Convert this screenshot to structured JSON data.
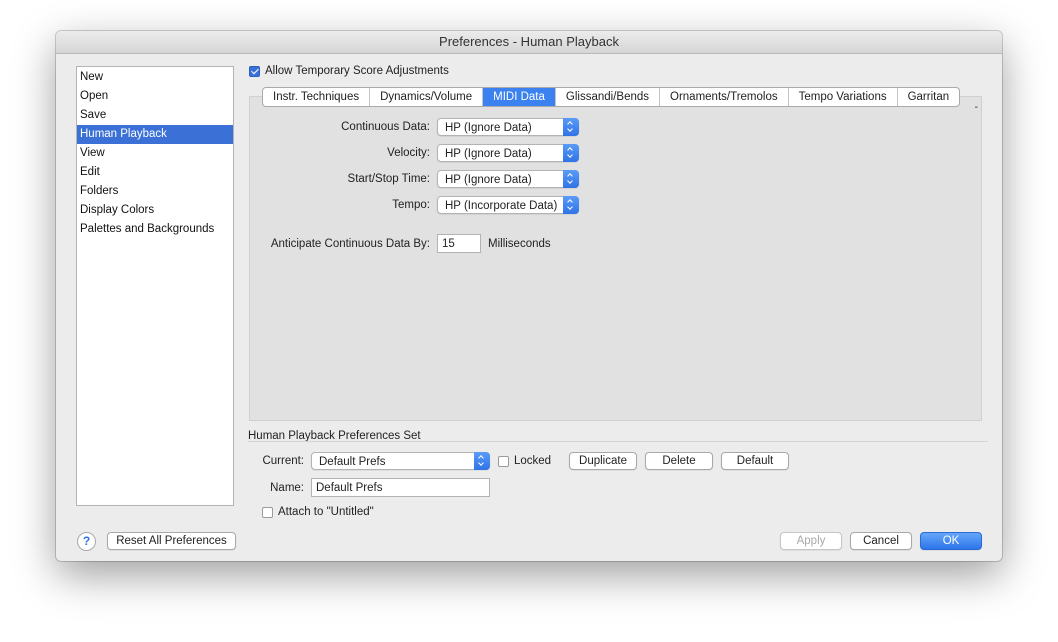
{
  "window": {
    "title": "Preferences - Human Playback"
  },
  "sidebar": {
    "items": [
      {
        "label": "New"
      },
      {
        "label": "Open"
      },
      {
        "label": "Save"
      },
      {
        "label": "Human Playback"
      },
      {
        "label": "View"
      },
      {
        "label": "Edit"
      },
      {
        "label": "Folders"
      },
      {
        "label": "Display Colors"
      },
      {
        "label": "Palettes and Backgrounds"
      }
    ],
    "selected": "Human Playback"
  },
  "allow_temp": {
    "label": "Allow Temporary Score Adjustments",
    "checked": true
  },
  "tabs": [
    {
      "label": "Instr. Techniques"
    },
    {
      "label": "Dynamics/Volume"
    },
    {
      "label": "MIDI Data"
    },
    {
      "label": "Glissandi/Bends"
    },
    {
      "label": "Ornaments/Tremolos"
    },
    {
      "label": "Tempo Variations"
    },
    {
      "label": "Garritan"
    }
  ],
  "selected_tab": "MIDI Data",
  "midi": {
    "continuous_label": "Continuous Data:",
    "continuous_value": "HP (Ignore Data)",
    "velocity_label": "Velocity:",
    "velocity_value": "HP (Ignore Data)",
    "startstop_label": "Start/Stop Time:",
    "startstop_value": "HP (Ignore Data)",
    "tempo_label": "Tempo:",
    "tempo_value": "HP (Incorporate Data)",
    "anticipate_label": "Anticipate Continuous Data By:",
    "anticipate_value": "15",
    "anticipate_unit": "Milliseconds",
    "panel_mark": "-"
  },
  "prefs_set": {
    "title": "Human Playback Preferences Set",
    "current_label": "Current:",
    "current_value": "Default Prefs",
    "locked_label": "Locked",
    "locked_checked": false,
    "duplicate_label": "Duplicate",
    "delete_label": "Delete",
    "default_label": "Default",
    "name_label": "Name:",
    "name_value": "Default Prefs",
    "attach_label": "Attach to \"Untitled\"",
    "attach_checked": false
  },
  "footer": {
    "help_glyph": "?",
    "reset_label": "Reset All Preferences",
    "apply_label": "Apply",
    "cancel_label": "Cancel",
    "ok_label": "OK"
  },
  "colors": {
    "accent": "#3b82f0",
    "selection": "#3b71d7",
    "window": "#ececec",
    "panel": "#e1e1e1"
  }
}
